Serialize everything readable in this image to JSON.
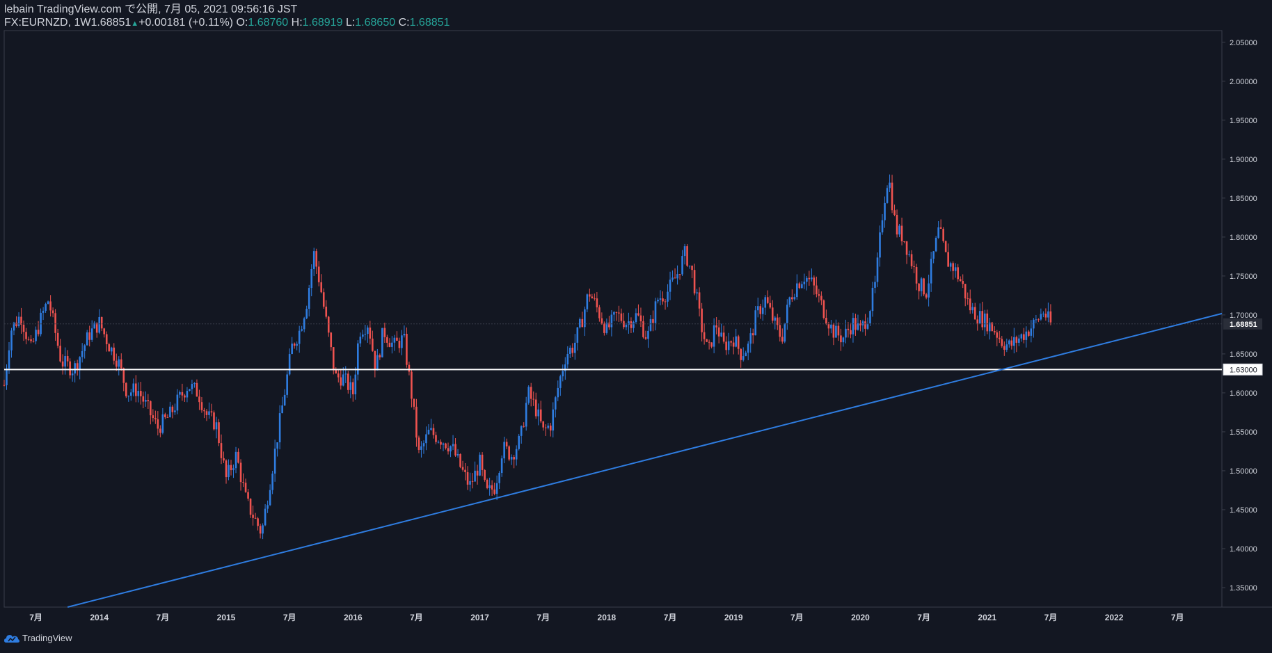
{
  "header": {
    "published_line": "lebain TradingView.com で公開, 7月 05, 2021 09:56:16 JST",
    "symbol": "FX:EURNZD, 1W",
    "last": "1.68851",
    "change": "+0.00181 (+0.11%)",
    "o_label": "O:",
    "o_value": "1.68760",
    "h_label": "H:",
    "h_value": "1.68919",
    "l_label": "L:",
    "l_value": "1.68650",
    "c_label": "C:",
    "c_value": "1.68851"
  },
  "footer": {
    "brand": "TradingView"
  },
  "colors": {
    "background": "#131722",
    "up": "#2f7de1",
    "down": "#ef5350",
    "trendline": "#2f7de1",
    "horizontal_line": "#ffffff",
    "text": "#d1d4dc",
    "accent": "#26a69a"
  },
  "chart_data": {
    "type": "candlestick",
    "symbol": "FX:EURNZD",
    "interval": "1W",
    "ylim": [
      1.325,
      2.065
    ],
    "y_ticks": [
      "2.05000",
      "2.00000",
      "1.95000",
      "1.90000",
      "1.85000",
      "1.80000",
      "1.75000",
      "1.70000",
      "1.65000",
      "1.60000",
      "1.55000",
      "1.50000",
      "1.45000",
      "1.40000",
      "1.35000"
    ],
    "x_ticks": [
      "7月",
      "2014",
      "7月",
      "2015",
      "7月",
      "2016",
      "7月",
      "2017",
      "7月",
      "2018",
      "7月",
      "2019",
      "7月",
      "2020",
      "7月",
      "2021",
      "7月",
      "2022",
      "7月"
    ],
    "x_tick_dates": [
      2013.5,
      2014.0,
      2014.5,
      2015.0,
      2015.5,
      2016.0,
      2016.5,
      2017.0,
      2017.5,
      2018.0,
      2018.5,
      2019.0,
      2019.5,
      2020.0,
      2020.5,
      2021.0,
      2021.5,
      2022.0,
      2022.5
    ],
    "price_labels": [
      {
        "value": "1.68851",
        "price": 1.68851,
        "style": "last"
      },
      {
        "value": "1.63000",
        "price": 1.63,
        "style": "level"
      }
    ],
    "horizontal_line": 1.63,
    "trendline": {
      "from": [
        2013.75,
        1.325
      ],
      "to": [
        2023.0,
        1.708
      ]
    },
    "price_path": [
      [
        2013.25,
        1.61
      ],
      [
        2013.3,
        1.68
      ],
      [
        2013.38,
        1.7
      ],
      [
        2013.46,
        1.655
      ],
      [
        2013.55,
        1.7
      ],
      [
        2013.6,
        1.72
      ],
      [
        2013.7,
        1.64
      ],
      [
        2013.8,
        1.63
      ],
      [
        2013.92,
        1.675
      ],
      [
        2014.0,
        1.69
      ],
      [
        2014.08,
        1.66
      ],
      [
        2014.15,
        1.64
      ],
      [
        2014.22,
        1.6
      ],
      [
        2014.3,
        1.605
      ],
      [
        2014.38,
        1.58
      ],
      [
        2014.46,
        1.555
      ],
      [
        2014.55,
        1.57
      ],
      [
        2014.62,
        1.59
      ],
      [
        2014.7,
        1.61
      ],
      [
        2014.78,
        1.6
      ],
      [
        2014.85,
        1.57
      ],
      [
        2014.92,
        1.56
      ],
      [
        2015.0,
        1.49
      ],
      [
        2015.08,
        1.52
      ],
      [
        2015.16,
        1.46
      ],
      [
        2015.22,
        1.44
      ],
      [
        2015.28,
        1.42
      ],
      [
        2015.34,
        1.48
      ],
      [
        2015.4,
        1.54
      ],
      [
        2015.46,
        1.6
      ],
      [
        2015.52,
        1.66
      ],
      [
        2015.58,
        1.68
      ],
      [
        2015.64,
        1.72
      ],
      [
        2015.69,
        1.78
      ],
      [
        2015.74,
        1.74
      ],
      [
        2015.8,
        1.68
      ],
      [
        2015.86,
        1.62
      ],
      [
        2015.92,
        1.62
      ],
      [
        2016.0,
        1.6
      ],
      [
        2016.05,
        1.68
      ],
      [
        2016.12,
        1.69
      ],
      [
        2016.18,
        1.63
      ],
      [
        2016.24,
        1.68
      ],
      [
        2016.32,
        1.66
      ],
      [
        2016.4,
        1.67
      ],
      [
        2016.46,
        1.6
      ],
      [
        2016.52,
        1.52
      ],
      [
        2016.6,
        1.55
      ],
      [
        2016.7,
        1.54
      ],
      [
        2016.78,
        1.53
      ],
      [
        2016.86,
        1.5
      ],
      [
        2016.92,
        1.48
      ],
      [
        2017.0,
        1.51
      ],
      [
        2017.05,
        1.47
      ],
      [
        2017.12,
        1.48
      ],
      [
        2017.18,
        1.53
      ],
      [
        2017.25,
        1.52
      ],
      [
        2017.32,
        1.54
      ],
      [
        2017.38,
        1.6
      ],
      [
        2017.44,
        1.58
      ],
      [
        2017.5,
        1.55
      ],
      [
        2017.56,
        1.56
      ],
      [
        2017.62,
        1.61
      ],
      [
        2017.68,
        1.65
      ],
      [
        2017.74,
        1.66
      ],
      [
        2017.8,
        1.69
      ],
      [
        2017.86,
        1.73
      ],
      [
        2017.92,
        1.71
      ],
      [
        2018.0,
        1.68
      ],
      [
        2018.08,
        1.7
      ],
      [
        2018.16,
        1.69
      ],
      [
        2018.24,
        1.7
      ],
      [
        2018.32,
        1.67
      ],
      [
        2018.4,
        1.72
      ],
      [
        2018.48,
        1.73
      ],
      [
        2018.55,
        1.75
      ],
      [
        2018.62,
        1.78
      ],
      [
        2018.68,
        1.75
      ],
      [
        2018.74,
        1.69
      ],
      [
        2018.8,
        1.65
      ],
      [
        2018.86,
        1.69
      ],
      [
        2018.92,
        1.66
      ],
      [
        2019.0,
        1.67
      ],
      [
        2019.06,
        1.65
      ],
      [
        2019.12,
        1.66
      ],
      [
        2019.18,
        1.7
      ],
      [
        2019.25,
        1.72
      ],
      [
        2019.32,
        1.69
      ],
      [
        2019.38,
        1.67
      ],
      [
        2019.44,
        1.72
      ],
      [
        2019.5,
        1.74
      ],
      [
        2019.56,
        1.75
      ],
      [
        2019.62,
        1.74
      ],
      [
        2019.7,
        1.71
      ],
      [
        2019.78,
        1.68
      ],
      [
        2019.86,
        1.67
      ],
      [
        2019.94,
        1.69
      ],
      [
        2020.0,
        1.68
      ],
      [
        2020.06,
        1.7
      ],
      [
        2020.12,
        1.74
      ],
      [
        2020.18,
        1.84
      ],
      [
        2020.22,
        1.88
      ],
      [
        2020.28,
        1.81
      ],
      [
        2020.34,
        1.8
      ],
      [
        2020.4,
        1.77
      ],
      [
        2020.46,
        1.74
      ],
      [
        2020.52,
        1.73
      ],
      [
        2020.58,
        1.78
      ],
      [
        2020.62,
        1.81
      ],
      [
        2020.68,
        1.77
      ],
      [
        2020.74,
        1.76
      ],
      [
        2020.8,
        1.74
      ],
      [
        2020.86,
        1.71
      ],
      [
        2020.92,
        1.7
      ],
      [
        2021.0,
        1.69
      ],
      [
        2021.06,
        1.68
      ],
      [
        2021.12,
        1.665
      ],
      [
        2021.18,
        1.66
      ],
      [
        2021.25,
        1.67
      ],
      [
        2021.32,
        1.68
      ],
      [
        2021.38,
        1.69
      ],
      [
        2021.44,
        1.705
      ],
      [
        2021.5,
        1.6885
      ]
    ]
  }
}
